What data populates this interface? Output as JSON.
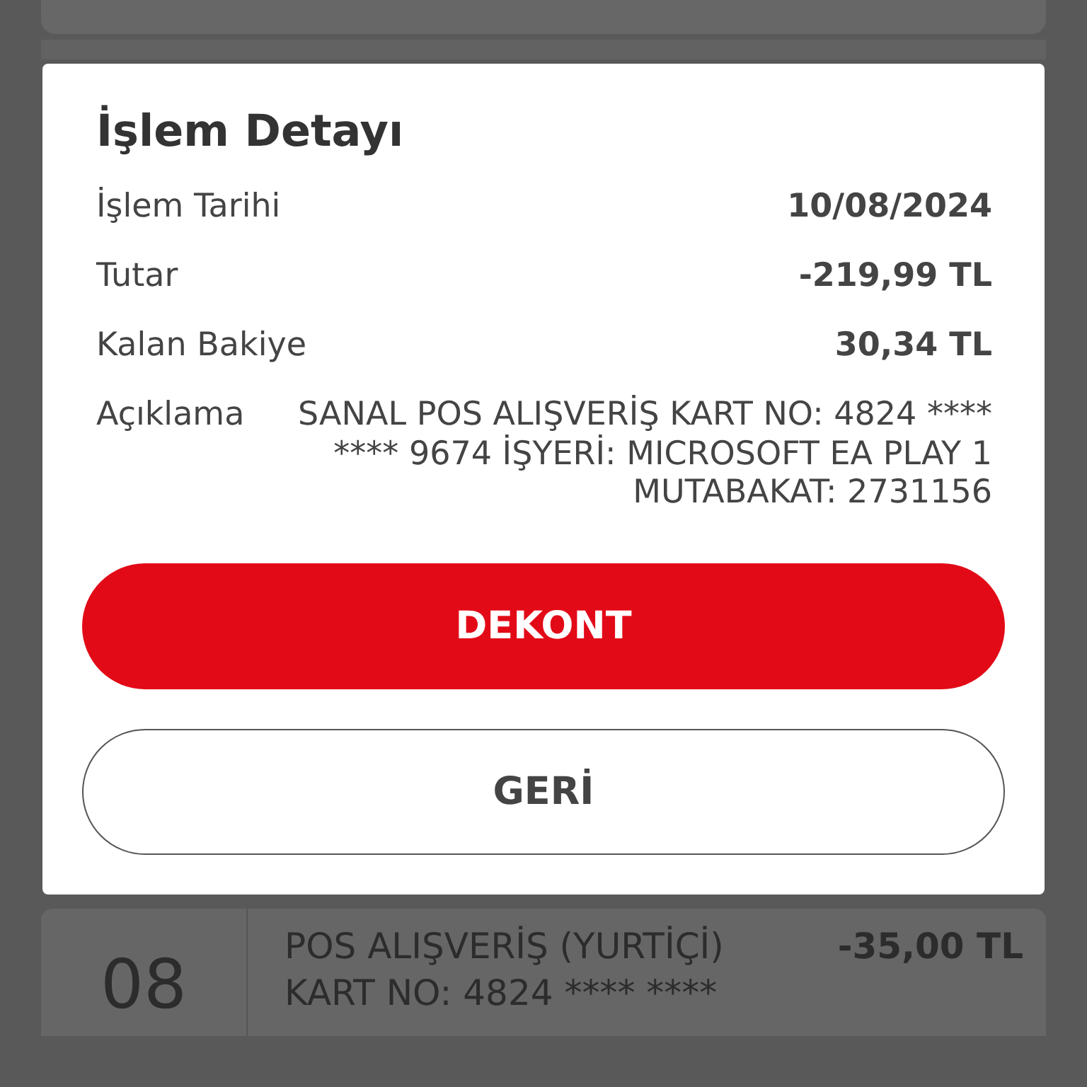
{
  "dialog": {
    "title": "İşlem Detayı",
    "rows": [
      {
        "label": "İşlem Tarihi",
        "value": "10/08/2024",
        "kind": "bold"
      },
      {
        "label": "Tutar",
        "value": "-219,99 TL",
        "kind": "bold"
      },
      {
        "label": "Kalan Bakiye",
        "value": "30,34 TL",
        "kind": "bold"
      },
      {
        "label": "Açıklama",
        "value": "SANAL POS ALIŞVERİŞ KART NO: 4824 **** **** 9674 İŞYERİ: MICROSOFT EA PLAY 1 MUTABAKAT: 2731156",
        "kind": "plain"
      }
    ],
    "buttons": [
      {
        "label": "DEKONT",
        "kind": "primary"
      },
      {
        "label": "GERİ",
        "kind": "secondary"
      }
    ]
  },
  "background_list": {
    "transactions": [
      {
        "day": "08",
        "title": "POS ALIŞVERİŞ (YURTİÇİ)",
        "amount": "-35,00 TL",
        "detail": "KART NO: 4824 **** ****"
      }
    ]
  }
}
